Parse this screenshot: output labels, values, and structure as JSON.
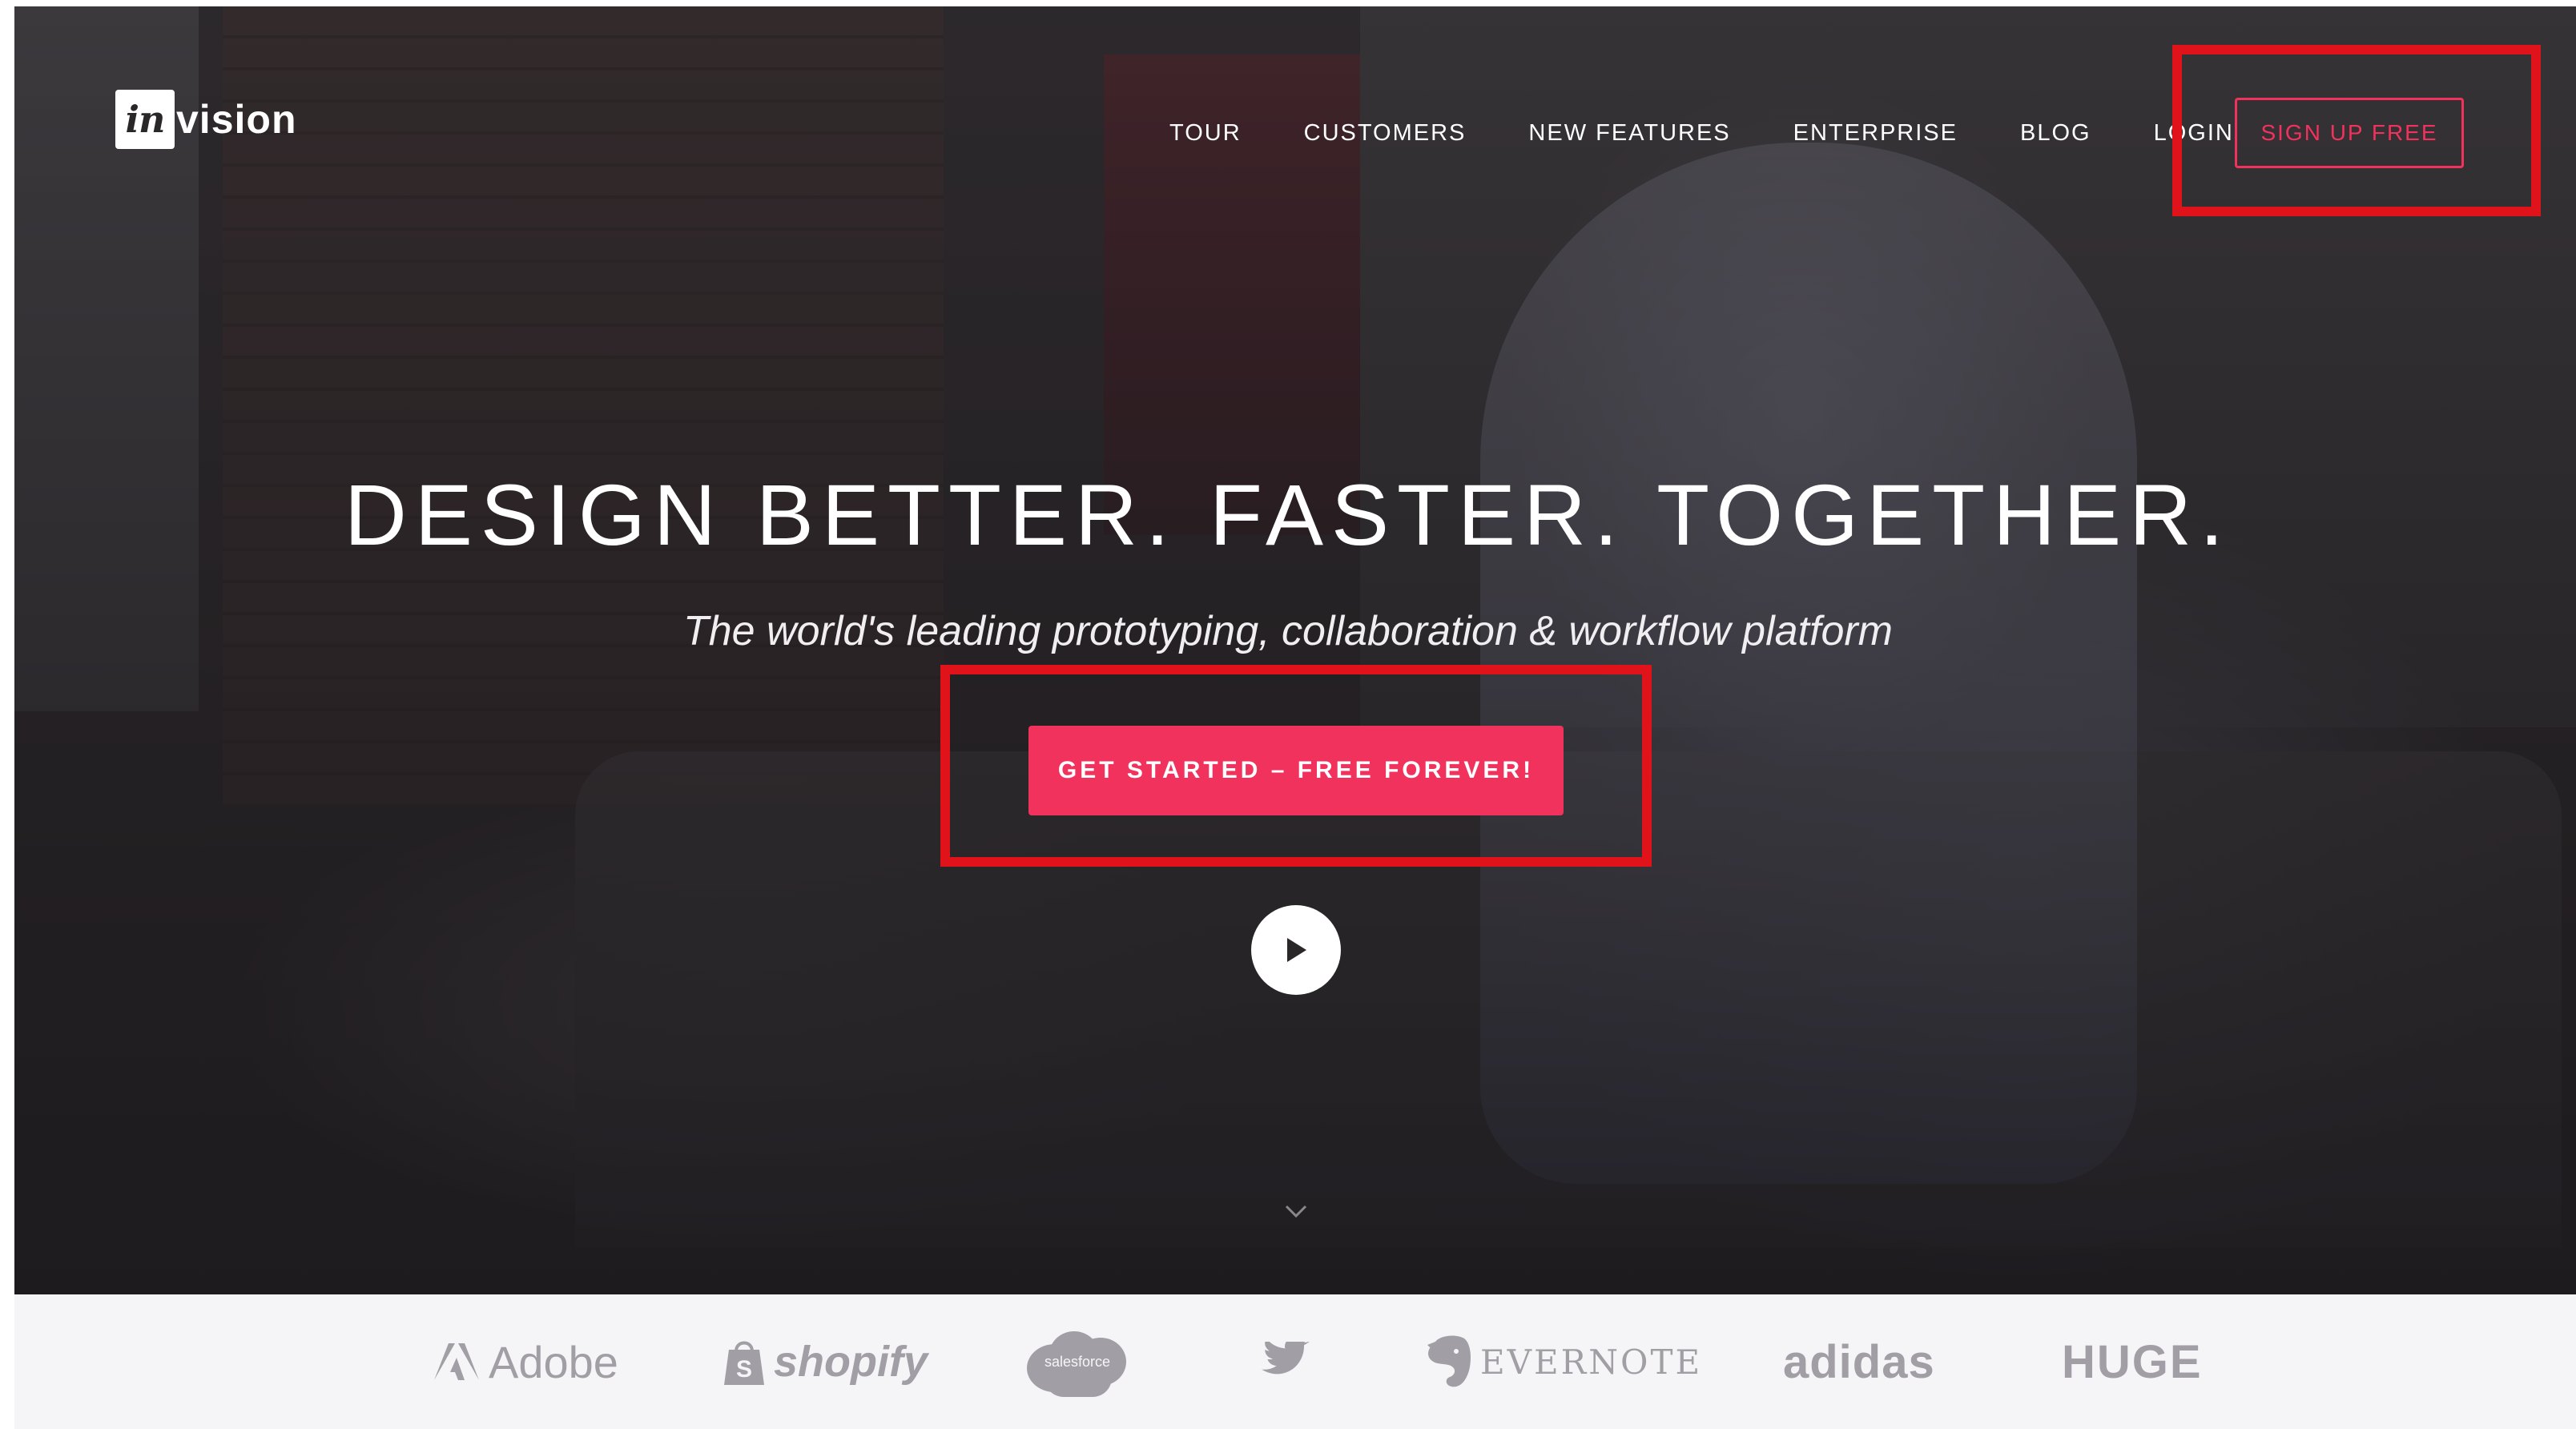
{
  "brand": {
    "logo_mark": "in",
    "logo_text": "vision",
    "accent_color": "#f1325c",
    "highlight_color": "#e0131a"
  },
  "nav": {
    "items": [
      {
        "label": "TOUR"
      },
      {
        "label": "CUSTOMERS"
      },
      {
        "label": "NEW FEATURES"
      },
      {
        "label": "ENTERPRISE"
      },
      {
        "label": "BLOG"
      },
      {
        "label": "LOGIN"
      }
    ],
    "signup_label": "SIGN UP FREE"
  },
  "hero": {
    "headline": "DESIGN BETTER. FASTER. TOGETHER.",
    "subheadline": "The world's leading prototyping, collaboration & workflow platform",
    "cta_label": "GET STARTED – FREE FOREVER!",
    "play_icon": "play-icon",
    "scroll_icon": "chevron-down-icon"
  },
  "clients": {
    "adobe": "Adobe",
    "shopify": "shopify",
    "salesforce": "salesforce",
    "twitter_icon": "twitter-bird-icon",
    "evernote": "EVERNOTE",
    "adidas": "adidas",
    "huge": "HUGE"
  }
}
